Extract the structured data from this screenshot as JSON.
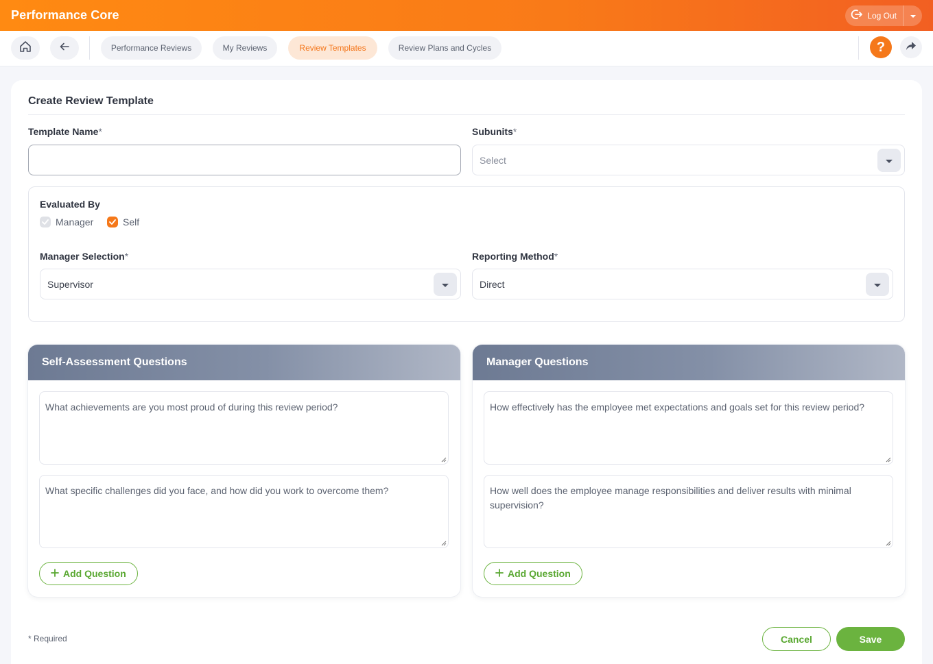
{
  "app": {
    "title": "Performance Core"
  },
  "header": {
    "logout_label": "Log Out",
    "logout_icon": "logout-icon",
    "menu_icon": "chevron-down-icon"
  },
  "nav": {
    "home_icon": "home-icon",
    "back_icon": "arrow-left-icon",
    "tabs": [
      {
        "label": "Performance Reviews",
        "active": false
      },
      {
        "label": "My Reviews",
        "active": false
      },
      {
        "label": "Review Templates",
        "active": true
      },
      {
        "label": "Review Plans and Cycles",
        "active": false
      }
    ],
    "help_label": "?",
    "share_icon": "share-icon"
  },
  "form": {
    "title": "Create Review Template",
    "template_name": {
      "label": "Template Name",
      "required_mark": "*",
      "value": ""
    },
    "subunits": {
      "label": "Subunits",
      "required_mark": "*",
      "placeholder": "Select"
    },
    "evaluated_by": {
      "label": "Evaluated By",
      "options": [
        {
          "label": "Manager",
          "checked": true,
          "disabled": true
        },
        {
          "label": "Self",
          "checked": true,
          "disabled": false
        }
      ]
    },
    "manager_selection": {
      "label": "Manager Selection",
      "required_mark": "*",
      "value": "Supervisor"
    },
    "reporting_method": {
      "label": "Reporting Method",
      "required_mark": "*",
      "value": "Direct"
    }
  },
  "self_questions": {
    "title": "Self-Assessment Questions",
    "items": [
      "What achievements are you most proud of during this review period?",
      "What specific challenges did you face, and how did you work to overcome them?"
    ],
    "add_label": "Add Question"
  },
  "manager_questions": {
    "title": "Manager Questions",
    "items": [
      "How effectively has the employee met expectations and goals set for this review period?",
      "How well does the employee manage responsibilities and deliver results with minimal supervision?"
    ],
    "add_label": "Add Question"
  },
  "footer": {
    "required_note": "* Required",
    "cancel_label": "Cancel",
    "save_label": "Save"
  },
  "colors": {
    "accent": "#f5781a",
    "success": "#6bb33f",
    "panel_header": "#7a869d"
  }
}
